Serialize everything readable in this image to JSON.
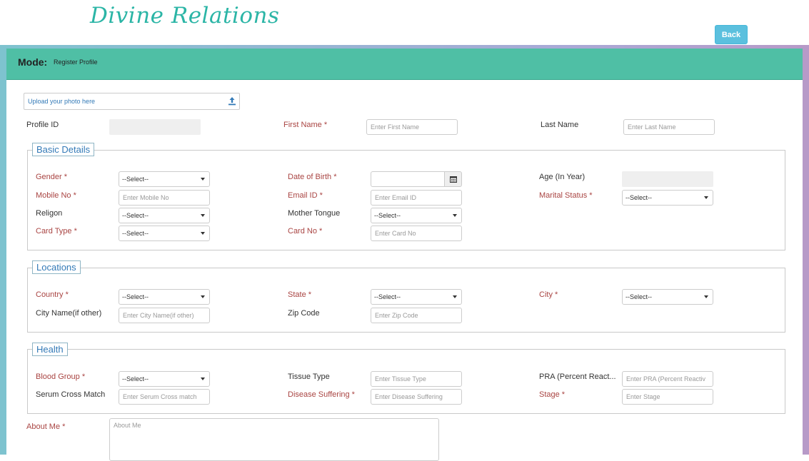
{
  "header": {
    "logo_text": "Divine Relations",
    "back_label": "Back"
  },
  "mode": {
    "label": "Mode:",
    "value": "Register Profile"
  },
  "upload": {
    "placeholder": "Upload your photo here"
  },
  "top_row": {
    "profile_id_label": "Profile ID",
    "first_name_label": "First Name *",
    "first_name_placeholder": "Enter First Name",
    "last_name_label": "Last Name",
    "last_name_placeholder": "Enter Last Name"
  },
  "basic": {
    "legend": "Basic Details",
    "gender_label": "Gender *",
    "gender_value": "--Select--",
    "dob_label": "Date of Birth *",
    "age_label": "Age (In Year)",
    "mobile_label": "Mobile No *",
    "mobile_placeholder": "Enter Mobile No",
    "email_label": "Email ID *",
    "email_placeholder": "Enter Email ID",
    "marital_label": "Marital Status *",
    "marital_value": "--Select--",
    "religion_label": "Religon",
    "religion_value": "--Select--",
    "tongue_label": "Mother Tongue",
    "tongue_value": "--Select--",
    "card_type_label": "Card Type *",
    "card_type_value": "--Select--",
    "card_no_label": "Card No *",
    "card_no_placeholder": "Enter Card No"
  },
  "locations": {
    "legend": "Locations",
    "country_label": "Country *",
    "country_value": "--Select--",
    "state_label": "State *",
    "state_value": "--Select--",
    "city_label": "City *",
    "city_value": "--Select--",
    "city_name_label": "City Name(if other)",
    "city_name_placeholder": "Enter City Name(if other)",
    "zip_label": "Zip Code",
    "zip_placeholder": "Enter Zip Code"
  },
  "health": {
    "legend": "Health",
    "blood_label": "Blood Group *",
    "blood_value": "--Select--",
    "tissue_label": "Tissue Type",
    "tissue_placeholder": "Enter Tissue Type",
    "pra_label": "PRA (Percent React...",
    "pra_placeholder": "Enter PRA (Percent Reactiv",
    "serum_label": "Serum Cross Match",
    "serum_placeholder": "Enter Serum Cross match",
    "disease_label": "Disease Suffering *",
    "disease_placeholder": "Enter Disease Suffering",
    "stage_label": "Stage *",
    "stage_placeholder": "Enter Stage"
  },
  "about": {
    "label": "About Me *",
    "placeholder": "About Me"
  },
  "colors": {
    "mode_bar": "#4fbfa5",
    "back_button": "#5bc0de",
    "required_label": "#a94442",
    "link": "#337ab7"
  },
  "icons": {
    "upload": "upload-icon",
    "calendar": "calendar-icon",
    "caret": "caret-down-icon"
  }
}
